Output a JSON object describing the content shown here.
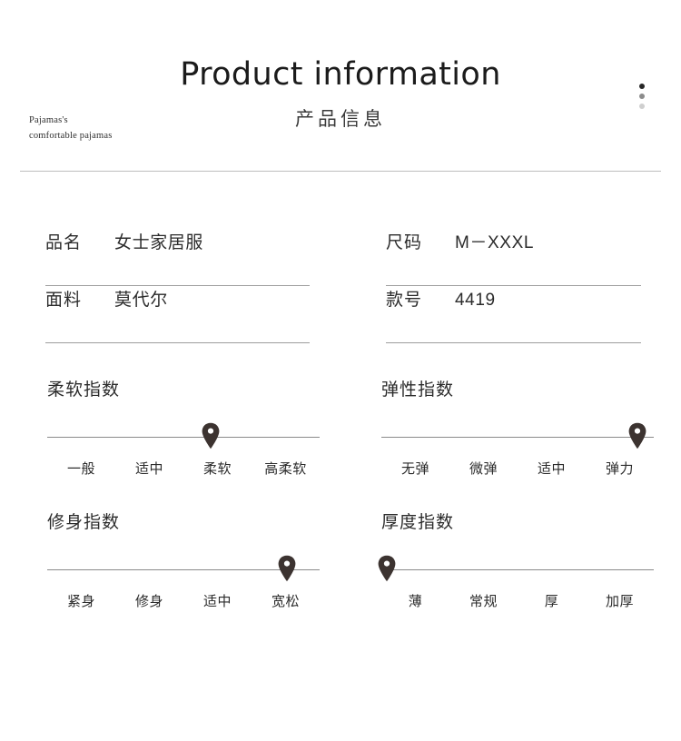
{
  "header": {
    "title_en": "Product information",
    "title_cn": "产品信息",
    "brand_line1": "Pajamas's",
    "brand_line2": "comfortable pajamas",
    "dot_colors": [
      "#262626",
      "#8c8c8c",
      "#cfcfcf"
    ]
  },
  "specs": {
    "rows": [
      {
        "key": "品名",
        "value": "女士家居服"
      },
      {
        "key": "尺码",
        "value": "M－XXXL"
      },
      {
        "key": "面料",
        "value": "莫代尔"
      },
      {
        "key": "款号",
        "value": "4419"
      }
    ]
  },
  "indices": [
    {
      "title": "柔软指数",
      "labels": [
        "一般",
        "适中",
        "柔软",
        "高柔软"
      ],
      "selected_index": 2,
      "selected_label": "柔软",
      "marker_percent": 60
    },
    {
      "title": "弹性指数",
      "labels": [
        "无弹",
        "微弹",
        "适中",
        "弹力"
      ],
      "selected_index": 3,
      "selected_label": "弹力",
      "marker_percent": 94
    },
    {
      "title": "修身指数",
      "labels": [
        "紧身",
        "修身",
        "适中",
        "宽松"
      ],
      "selected_index": 3,
      "selected_label": "宽松",
      "marker_percent": 88
    },
    {
      "title": "厚度指数",
      "labels": [
        "薄",
        "常规",
        "厚",
        "加厚"
      ],
      "selected_index": 0,
      "selected_label": "薄",
      "marker_percent": 2
    }
  ],
  "colors": {
    "marker": "#3c3330",
    "track": "#8a8a8a",
    "divider": "#bdbdbd",
    "text": "#2b2b2b"
  }
}
